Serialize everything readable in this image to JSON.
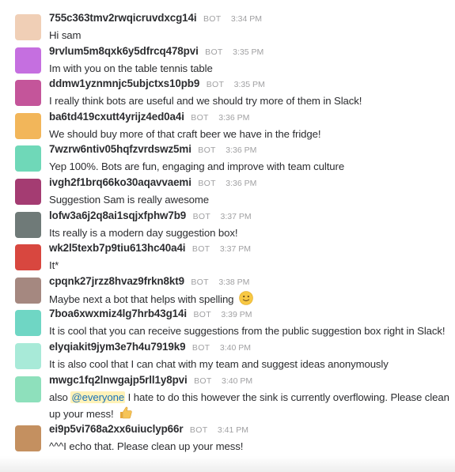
{
  "messages": [
    {
      "username": "755c363tmv2rwqicruvdxcg14i",
      "bot_tag": "BOT",
      "time": "3:34 PM",
      "text": "Hi sam",
      "avatar_color": "#f0cfb6"
    },
    {
      "username": "9rvlum5m8qxk6y5dfrcq478pvi",
      "bot_tag": "BOT",
      "time": "3:35 PM",
      "text": "Im with you on the table tennis table",
      "avatar_color": "#c56fe0"
    },
    {
      "username": "ddmw1yznmnjc5ubjctxs10pb9",
      "bot_tag": "BOT",
      "time": "3:35 PM",
      "text": "I really think bots are useful and we should try more of them in Slack!",
      "avatar_color": "#c4559a"
    },
    {
      "username": "ba6td419cxutt4yrijz4ed0a4i",
      "bot_tag": "BOT",
      "time": "3:36 PM",
      "text": "We should buy more of that craft beer we have in the fridge!",
      "avatar_color": "#f2b65a"
    },
    {
      "username": "7wzrw6ntiv05hqfzvrdswz5mi",
      "bot_tag": "BOT",
      "time": "3:36 PM",
      "text": "Yep 100%. Bots are fun, engaging and improve with team culture",
      "avatar_color": "#6fd8b8"
    },
    {
      "username": "ivgh2f1brq66ko30aqavvaemi",
      "bot_tag": "BOT",
      "time": "3:36 PM",
      "text": "Suggestion Sam is really awesome",
      "avatar_color": "#a43c72"
    },
    {
      "username": "lofw3a6j2q8ai1sqjxfphw7b9",
      "bot_tag": "BOT",
      "time": "3:37 PM",
      "text": "Its really is a modern day suggestion box!",
      "avatar_color": "#6f7a78"
    },
    {
      "username": "wk2l5texb7p9tiu613hc40a4i",
      "bot_tag": "BOT",
      "time": "3:37 PM",
      "text": "It*",
      "avatar_color": "#d8473f"
    },
    {
      "username": "cpqnk27jrzz8hvaz9frkn8kt9",
      "bot_tag": "BOT",
      "time": "3:38 PM",
      "text": "Maybe next a bot that helps with spelling",
      "avatar_color": "#a58880"
    },
    {
      "username": "7boa6xwxmiz4lg7hrb43g14i",
      "bot_tag": "BOT",
      "time": "3:39 PM",
      "text": "It is cool that you can receive suggestions from the public suggestion box right in Slack!",
      "avatar_color": "#6fd6c4"
    },
    {
      "username": "elyqiakit9jym3e7h4u7919k9",
      "bot_tag": "BOT",
      "time": "3:40 PM",
      "text": "It is also cool that I can chat with my team and suggest ideas anonymously",
      "avatar_color": "#a8ead8"
    },
    {
      "username": "mwgc1fq2lnwgajp5rll1y8pvi",
      "bot_tag": "BOT",
      "time": "3:40 PM",
      "text_before": "also ",
      "mention": "@everyone",
      "text_after": " I hate to do this however the sink is currently overflowing. Please clean up your mess!",
      "avatar_color": "#8ee0bc"
    },
    {
      "username": "ei9p5vi768a2xx6uiuclyp66r",
      "bot_tag": "BOT",
      "time": "3:41 PM",
      "text": "^^^I echo that. Please clean up your mess!",
      "avatar_color": "#c49060"
    }
  ],
  "icons": {
    "smile_emoji": "slightly-smiling-face-icon",
    "thumbs_up_emoji": "thumbs-up-icon"
  }
}
